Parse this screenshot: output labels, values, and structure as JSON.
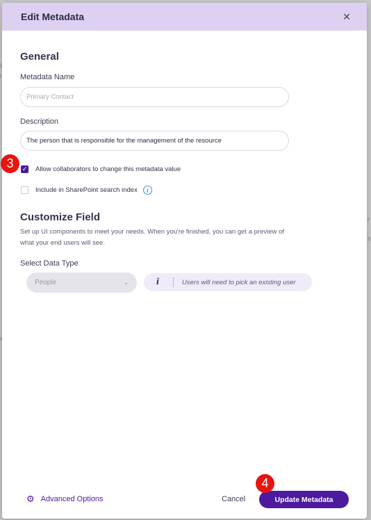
{
  "dialog": {
    "title": "Edit Metadata",
    "close_icon": "close-icon"
  },
  "general": {
    "title": "General",
    "name_label": "Metadata Name",
    "name_placeholder": "Primary Contact",
    "description_label": "Description",
    "description_value": "The person that is responsible for the management of the resource",
    "allow_collaborators_label": "Allow collaborators to change this metadata value",
    "allow_collaborators_checked": true,
    "include_search_label": "Include in SharePoint search index",
    "include_search_checked": false
  },
  "customize": {
    "title": "Customize Field",
    "help_text": "Set up UI components to meet your needs. When you're finished, you can get a preview of what your end users will see.",
    "data_type_label": "Select Data Type",
    "data_type_value": "People",
    "info_glyph": "i",
    "info_text": "Users will need to pick an existing user"
  },
  "footer": {
    "advanced_options": "Advanced Options",
    "cancel": "Cancel",
    "update": "Update Metadata"
  },
  "annotations": {
    "badge_3": "3",
    "badge_4": "4"
  },
  "colors": {
    "header_bg": "#ddd0f0",
    "primary": "#4c1a9e",
    "badge": "#e8140f",
    "info_blue": "#3d8fd9"
  }
}
